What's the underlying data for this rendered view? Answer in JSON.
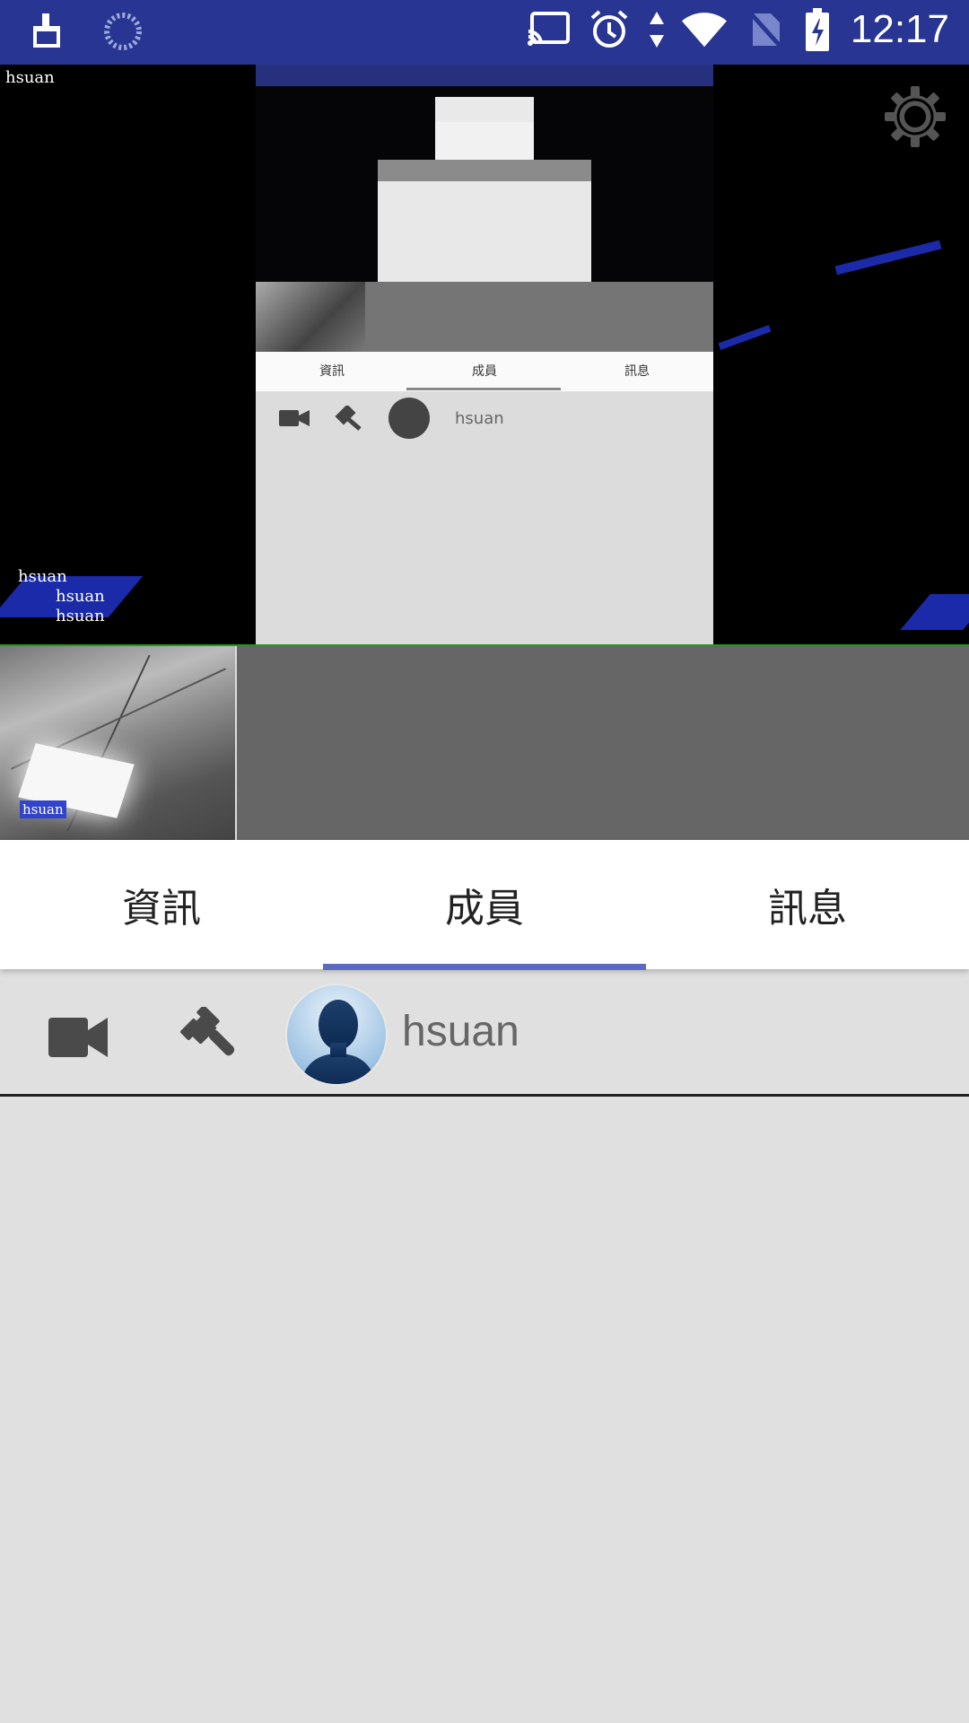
{
  "status_bar": {
    "time": "12:17",
    "left_icons": [
      "cleaner-icon",
      "spinner-icon"
    ],
    "right_icons": [
      "cast-icon",
      "alarm-icon",
      "data-arrows-icon",
      "wifi-icon",
      "no-sim-icon",
      "battery-charging-icon"
    ]
  },
  "main_video": {
    "overlay_top_left": "hsuan",
    "overlay_bottom_lines": [
      "hsuan",
      "hsuan",
      "hsuan"
    ],
    "settings_icon": "gear-icon",
    "nested": {
      "tabs": [
        "資訊",
        "成員",
        "訊息"
      ],
      "member_name": "hsuan"
    }
  },
  "thumbnails": [
    {
      "label": "hsuan"
    }
  ],
  "tabs": [
    {
      "label": "資訊",
      "selected": false
    },
    {
      "label": "成員",
      "selected": true
    },
    {
      "label": "訊息",
      "selected": false
    }
  ],
  "members": [
    {
      "name": "hsuan",
      "icons": [
        "video-camera-icon",
        "gavel-icon"
      ]
    }
  ],
  "colors": {
    "status_bar": "#283593",
    "tab_indicator": "#5c6bc0",
    "background": "#e0e0e0"
  }
}
